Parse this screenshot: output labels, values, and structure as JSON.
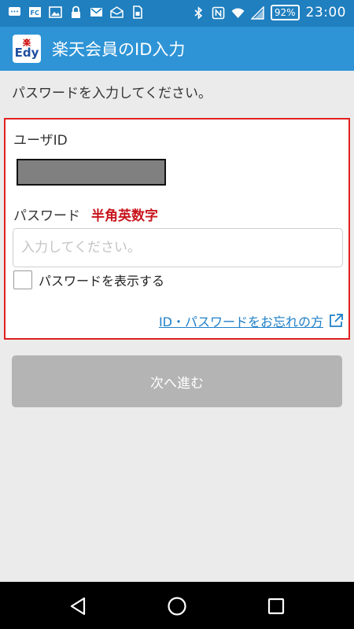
{
  "status_bar": {
    "battery": "92%",
    "time": "23:00",
    "left_icons": [
      "chat-icon",
      "fc-icon",
      "image-icon",
      "lock-icon",
      "gmail-icon",
      "mail-open-icon",
      "sim-icon"
    ],
    "right_icons": [
      "bluetooth-icon",
      "nfc-icon",
      "wifi-icon",
      "signal-icon"
    ]
  },
  "app_bar": {
    "logo_top": "楽",
    "logo_bottom": "Edy",
    "title": "楽天会員のID入力"
  },
  "instruction": "パスワードを入力してください。",
  "form": {
    "userid_label": "ユーザID",
    "password_label": "パスワード",
    "password_hint": "半角英数字",
    "password_placeholder": "入力してください。",
    "password_value": "",
    "show_password_label": "パスワードを表示する",
    "show_password_checked": false,
    "forgot_link": "ID・パスワードをお忘れの方"
  },
  "next_button": "次へ進む",
  "colors": {
    "status_bar": "#1f7fbf",
    "app_bar": "#2e94d6",
    "highlight_border": "#e02020",
    "hint_red": "#c8161d",
    "link_blue": "#1e7fc8",
    "disabled_button": "#b4b4b4"
  }
}
